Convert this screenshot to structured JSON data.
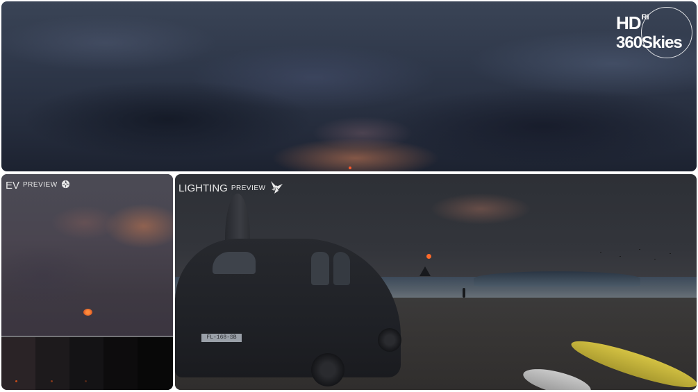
{
  "logo": {
    "line1": "HD",
    "line1_small": "RI",
    "line2": "360",
    "line2_b": "Skies"
  },
  "ev_preview": {
    "label_main": "EV",
    "label_small": "PREVIEW",
    "icon": "aperture-icon"
  },
  "lighting_preview": {
    "label_main": "LIGHTING",
    "label_small": "PREVIEW",
    "icon": "light-rays-icon",
    "plate_text": "FL-168-SB"
  },
  "colors": {
    "sun": "#ff6a2a",
    "board": "#d4c243",
    "label": "#e9e9e9"
  }
}
